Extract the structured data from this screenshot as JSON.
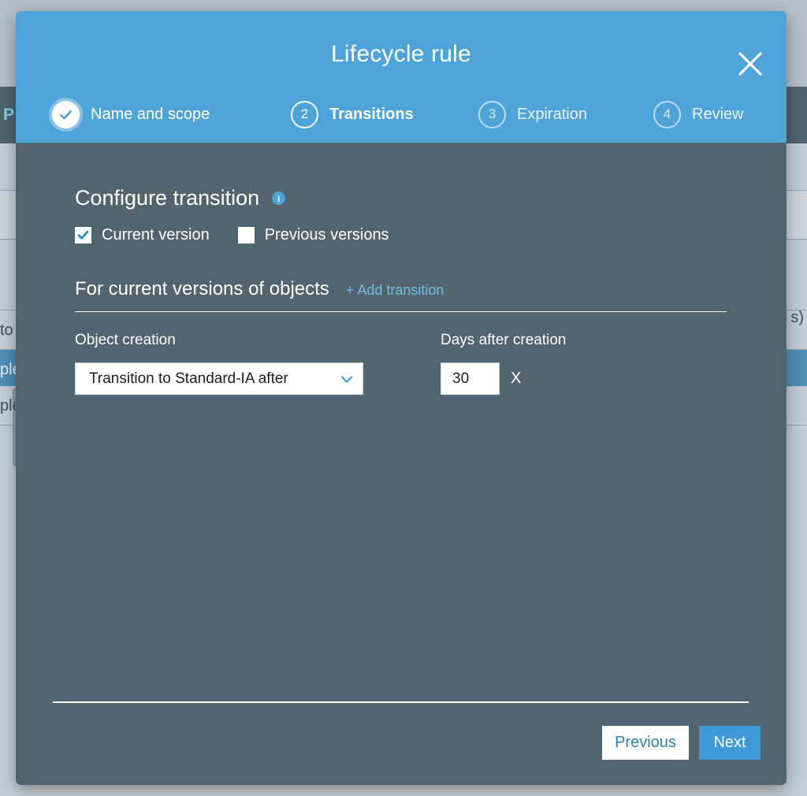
{
  "background": {
    "nav_fragment": "P",
    "rows": [
      {
        "text": "",
        "style": "plain"
      },
      {
        "text": "",
        "style": "plain"
      },
      {
        "text": "",
        "style": "plain"
      },
      {
        "text": "to",
        "style": "plain"
      },
      {
        "text": "ple",
        "style": "selected"
      },
      {
        "text": "ple",
        "style": "plain"
      }
    ],
    "right_fragment": "s)"
  },
  "modal": {
    "title": "Lifecycle rule",
    "close_icon": "close-icon",
    "steps": [
      {
        "number": "1",
        "label": "Name and scope",
        "state": "completed"
      },
      {
        "number": "2",
        "label": "Transitions",
        "state": "active"
      },
      {
        "number": "3",
        "label": "Expiration",
        "state": "upcoming"
      },
      {
        "number": "4",
        "label": "Review",
        "state": "upcoming"
      }
    ],
    "section": {
      "title": "Configure transition",
      "info_icon": "info-icon",
      "checkboxes": [
        {
          "label": "Current version",
          "checked": true
        },
        {
          "label": "Previous versions",
          "checked": false
        }
      ]
    },
    "subsection": {
      "title": "For current versions of objects",
      "add_link": "+ Add transition"
    },
    "fields": {
      "object_creation_label": "Object creation",
      "object_creation_value": "Transition to Standard-IA after",
      "days_label": "Days after creation",
      "days_value": "30",
      "remove_label": "X"
    },
    "footer": {
      "previous_label": "Previous",
      "next_label": "Next"
    },
    "colors": {
      "header_blue": "#4ea3d8",
      "body_slate": "#52656f",
      "link_blue": "#72bde8",
      "next_button_blue": "#3d9ad6",
      "previous_text_blue": "#2d7eb5",
      "page_background": "#acbac4"
    }
  }
}
